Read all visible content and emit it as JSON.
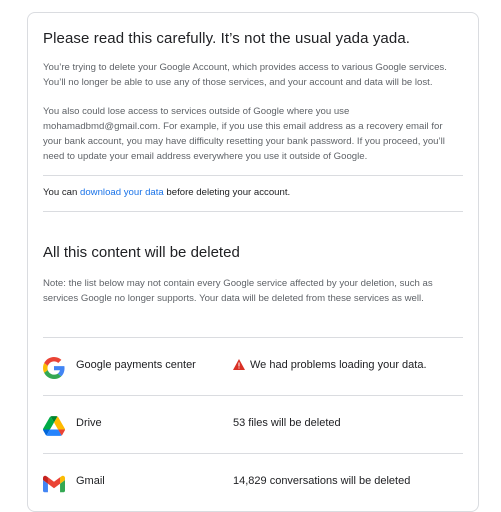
{
  "header": {
    "title": "Please read this carefully. It’s not the usual yada yada."
  },
  "intro": {
    "paragraph1": "You’re trying to delete your Google Account, which provides access to various Google services. You’ll no longer be able to use any of those services, and your account and data will be lost.",
    "paragraph2": "You also could lose access to services outside of Google where you use mohamadbmd@gmail.com. For example, if you use this email address as a recovery email for your bank account, you may have difficulty resetting your bank password. If you proceed, you’ll need to update your email address everywhere you use it outside of Google."
  },
  "download": {
    "prefix": "You can ",
    "link": "download your data",
    "suffix": " before deleting your account."
  },
  "content": {
    "title": "All this content will be deleted",
    "note": "Note: the list below may not contain every Google service affected by your deletion, such as services Google no longer supports. Your data will be deleted from these services as well."
  },
  "services": [
    {
      "name": "Google payments center",
      "icon": "google-g-icon",
      "status": "We had problems loading your data."
    },
    {
      "name": "Drive",
      "icon": "google-drive-icon",
      "status": "53 files will be deleted"
    },
    {
      "name": "Gmail",
      "icon": "gmail-icon",
      "status": "14,829 conversations will be deleted"
    }
  ],
  "colors": {
    "link": "#1a73e8",
    "warning": "#d93025",
    "divider": "#dadce0"
  }
}
